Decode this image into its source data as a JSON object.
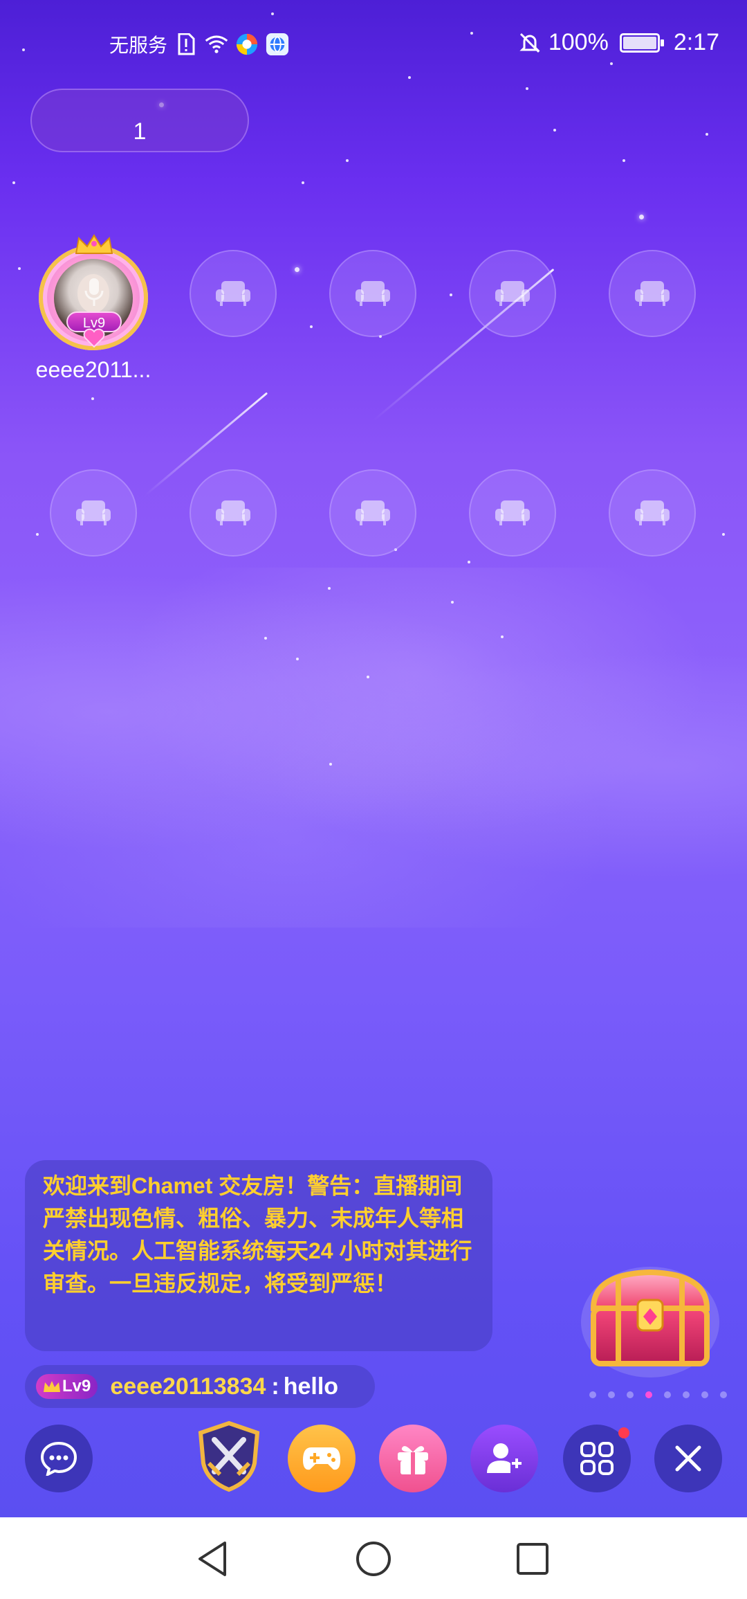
{
  "status_bar": {
    "carrier": "无服务",
    "battery_percent": "100%",
    "time": "2:17",
    "icons": [
      "sim-alert-icon",
      "wifi-icon",
      "browser-icon",
      "globe-app-icon",
      "bell-off-icon",
      "battery-charging-icon"
    ]
  },
  "room": {
    "id_label": "1"
  },
  "seats": {
    "host": {
      "name": "eeee2011...",
      "level": "Lv9"
    },
    "empty_seat_icon": "sofa-icon",
    "empty_count": 9
  },
  "chat": {
    "notice": "欢迎来到Chamet 交友房！警告：直播期间严禁出现色情、粗俗、暴力、未成年人等相关情况。人工智能系统每天24 小时对其进行审查。一旦违反规定，将受到严惩！",
    "messages": [
      {
        "level": "Lv9",
        "user": "eeee20113834",
        "separator": ":",
        "text": "hello"
      }
    ]
  },
  "pager": {
    "count": 8,
    "active_index": 3
  },
  "toolbar": {
    "items": [
      "chat-bubble-icon",
      "shield-swords-icon",
      "gamepad-icon",
      "gift-icon",
      "add-user-icon",
      "apps-grid-icon",
      "close-icon"
    ]
  },
  "colors": {
    "notice_text": "#ffcf2e",
    "username": "#ffd84a",
    "accent_pink": "#ff4fd8"
  }
}
